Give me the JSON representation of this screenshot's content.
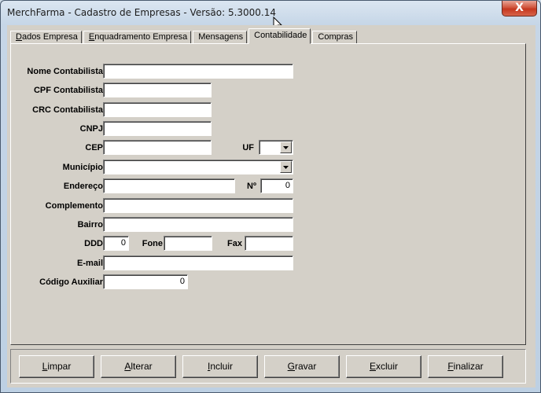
{
  "window": {
    "title": "MerchFarma - Cadastro de Empresas - Versão: 5.3000.14",
    "close_label": "X"
  },
  "tabs": [
    {
      "accel": "D",
      "rest": "ados Empresa"
    },
    {
      "accel": "E",
      "rest": "nquadramento Empresa"
    },
    {
      "accel": "",
      "rest": "Mensagens"
    },
    {
      "accel": "",
      "rest": "Contabilidade"
    },
    {
      "accel": "",
      "rest": "Compras"
    }
  ],
  "form": {
    "nome_label": "Nome Contabilista",
    "nome_value": "",
    "cpf_label": "CPF Contabilista",
    "cpf_value": "",
    "crc_label": "CRC Contabilista",
    "crc_value": "",
    "cnpj_label": "CNPJ",
    "cnpj_value": "",
    "cep_label": "CEP",
    "cep_value": "",
    "uf_label": "UF",
    "uf_value": "",
    "municipio_label": "Município",
    "municipio_value": "",
    "endereco_label": "Endereço",
    "endereco_value": "",
    "numero_label": "Nº",
    "numero_value": "0",
    "complemento_label": "Complemento",
    "complemento_value": "",
    "bairro_label": "Bairro",
    "bairro_value": "",
    "ddd_label": "DDD",
    "ddd_value": "0",
    "fone_label": "Fone",
    "fone_value": "",
    "fax_label": "Fax",
    "fax_value": "",
    "email_label": "E-mail",
    "email_value": "",
    "codigo_label": "Código Auxiliar",
    "codigo_value": "0"
  },
  "buttons": [
    {
      "accel": "L",
      "rest": "impar"
    },
    {
      "accel": "A",
      "rest": "lterar"
    },
    {
      "accel": "I",
      "rest": "ncluir"
    },
    {
      "accel": "G",
      "rest": "ravar"
    },
    {
      "accel": "E",
      "rest": "xcluir"
    },
    {
      "accel": "F",
      "rest": "inalizar"
    }
  ]
}
